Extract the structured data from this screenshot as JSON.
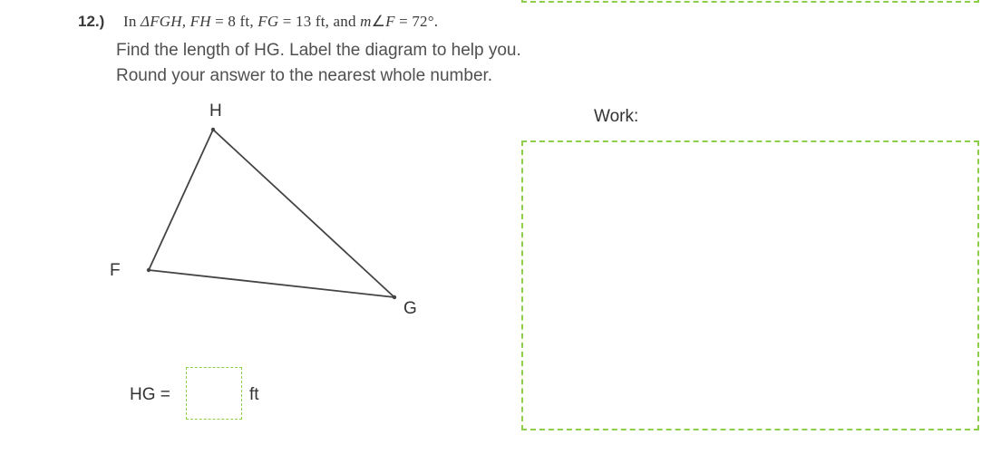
{
  "question": {
    "number": "12.)",
    "given_html": "In ΔFGH, FH = 8 ft, FG = 13 ft, and m∠F = 72°.",
    "instruction_line1": "Find the length of HG. Label the diagram to help you.",
    "instruction_line2": "Round your answer to the nearest whole number."
  },
  "diagram": {
    "vertices": {
      "F": "F",
      "G": "G",
      "H": "H"
    }
  },
  "work": {
    "label": "Work:"
  },
  "answer": {
    "prefix": "HG =",
    "value": "",
    "unit": "ft"
  }
}
